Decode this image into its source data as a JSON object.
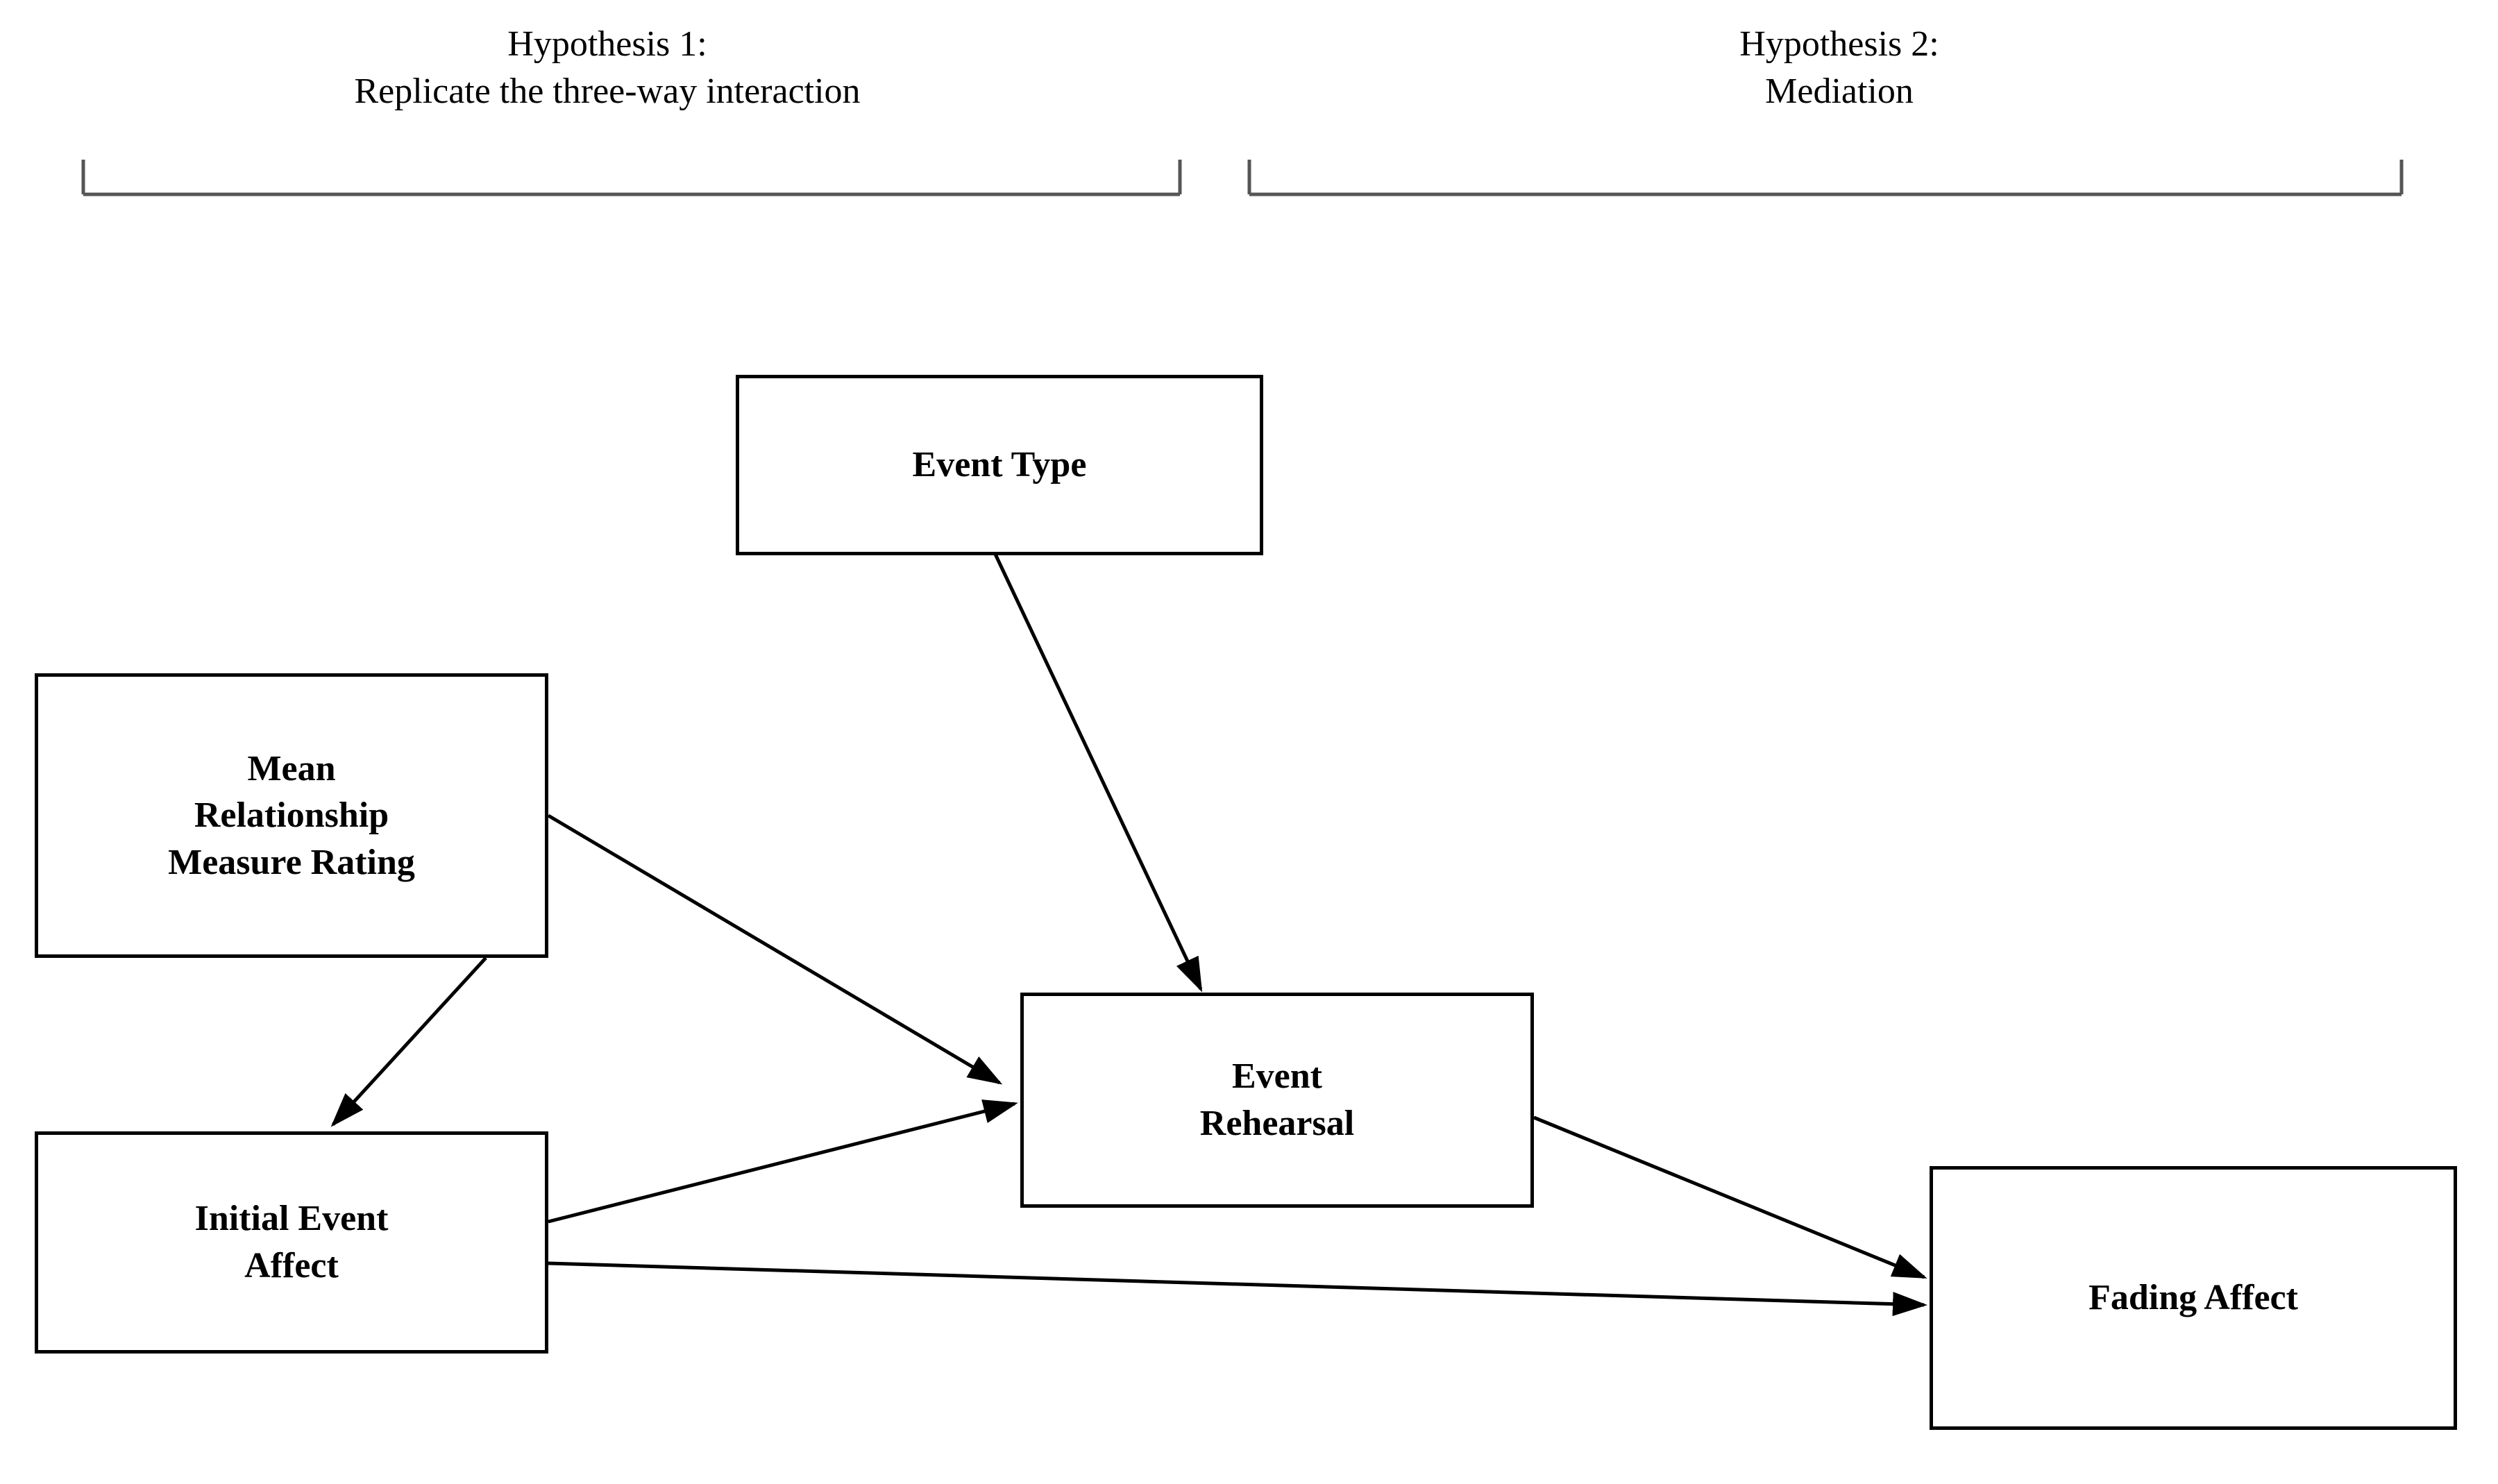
{
  "hypotheses": {
    "h1": {
      "title_line1": "Hypothesis 1:",
      "title_line2": "Replicate the three-way interaction"
    },
    "h2": {
      "title_line1": "Hypothesis 2:",
      "title_line2": "Mediation"
    }
  },
  "nodes": {
    "event_type": "Event Type",
    "mean_relationship": "Mean\nRelationship\nMeasure Rating",
    "initial_event_affect": "Initial Event\nAffect",
    "event_rehearsal": "Event\nRehearsal",
    "fading_affect": "Fading Affect"
  }
}
